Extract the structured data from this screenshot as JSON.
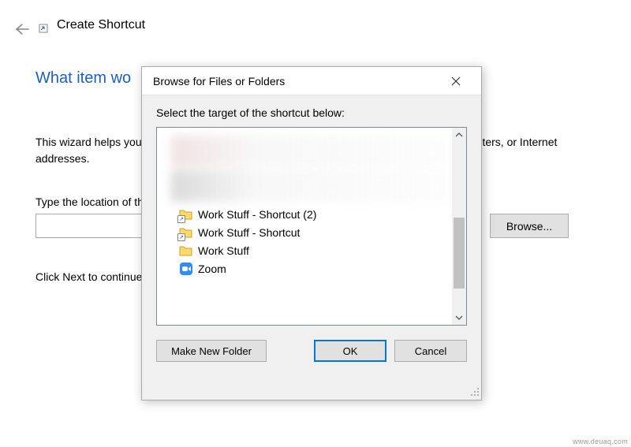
{
  "wizard": {
    "title": "Create Shortcut",
    "heading": "What item wo",
    "description": "This wizard helps you to create shortcuts to local or network programs, files, folders, computers, or Internet addresses.",
    "location_label": "Type the location of the item:",
    "location_value": "",
    "browse_label": "Browse...",
    "next_hint": "Click Next to continue."
  },
  "dialog": {
    "title": "Browse for Files or Folders",
    "instruction": "Select the target of the shortcut below:",
    "items": [
      {
        "label": "Work Stuff - Shortcut (2)",
        "icon": "folder-shortcut"
      },
      {
        "label": "Work Stuff - Shortcut",
        "icon": "folder-shortcut"
      },
      {
        "label": "Work Stuff",
        "icon": "folder"
      },
      {
        "label": "Zoom",
        "icon": "zoom"
      }
    ],
    "make_folder_label": "Make New Folder",
    "ok_label": "OK",
    "cancel_label": "Cancel"
  },
  "watermark": "www.deuaq.com"
}
